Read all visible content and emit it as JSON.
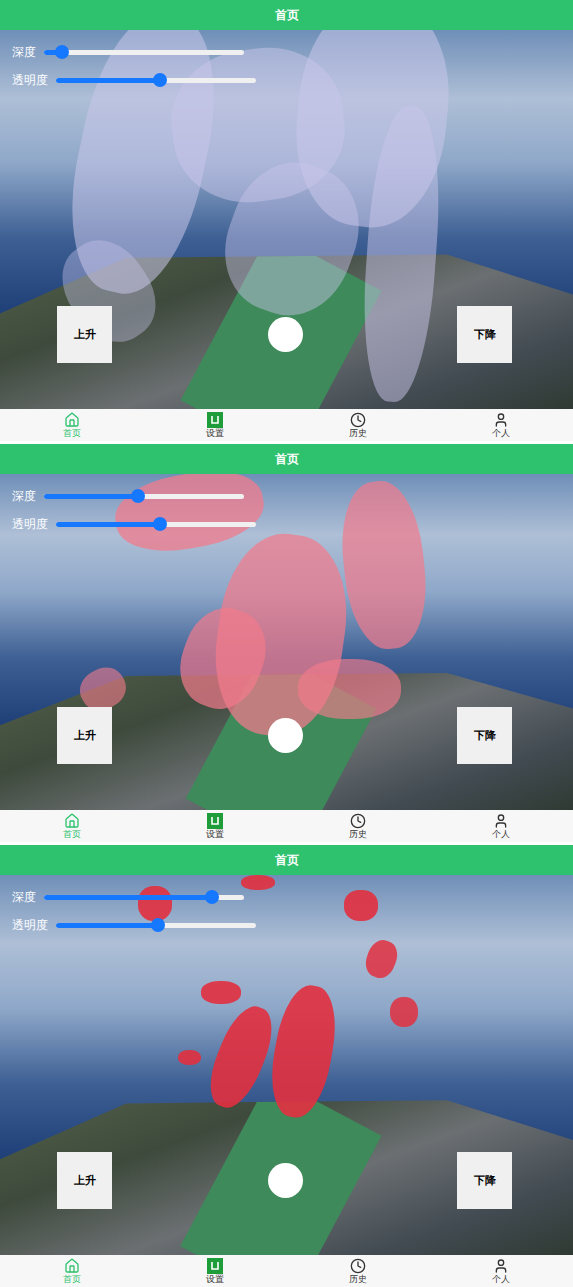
{
  "screens": [
    {
      "header": {
        "title": "首页"
      },
      "sliders": [
        {
          "label": "深度",
          "level": 0.09
        },
        {
          "label": "透明度",
          "level": 0.52
        }
      ],
      "buttons": [
        "上升",
        "下降"
      ],
      "plume": {
        "kind": "veil",
        "color": "#c9c6ea"
      },
      "nav": [
        {
          "label": "首页",
          "selected": true
        },
        {
          "label": "设置",
          "selected": false
        },
        {
          "label": "历史",
          "selected": false
        },
        {
          "label": "个人",
          "selected": false
        }
      ]
    },
    {
      "header": {
        "title": "首页"
      },
      "sliders": [
        {
          "label": "深度",
          "level": 0.47
        },
        {
          "label": "透明度",
          "level": 0.52
        }
      ],
      "buttons": [
        "上升",
        "下降"
      ],
      "plume": {
        "kind": "mass",
        "color": "#f27b8c"
      },
      "nav": [
        {
          "label": "首页",
          "selected": true
        },
        {
          "label": "设置",
          "selected": false
        },
        {
          "label": "历史",
          "selected": false
        },
        {
          "label": "个人",
          "selected": false
        }
      ]
    },
    {
      "header": {
        "title": "首页"
      },
      "sliders": [
        {
          "label": "深度",
          "level": 0.84
        },
        {
          "label": "透明度",
          "level": 0.51
        }
      ],
      "buttons": [
        "上升",
        "下降"
      ],
      "plume": {
        "kind": "blobs",
        "color": "#e2303f"
      },
      "nav": [
        {
          "label": "首页",
          "selected": true
        },
        {
          "label": "设置",
          "selected": false
        },
        {
          "label": "历史",
          "selected": false
        },
        {
          "label": "个人",
          "selected": false
        }
      ]
    }
  ]
}
